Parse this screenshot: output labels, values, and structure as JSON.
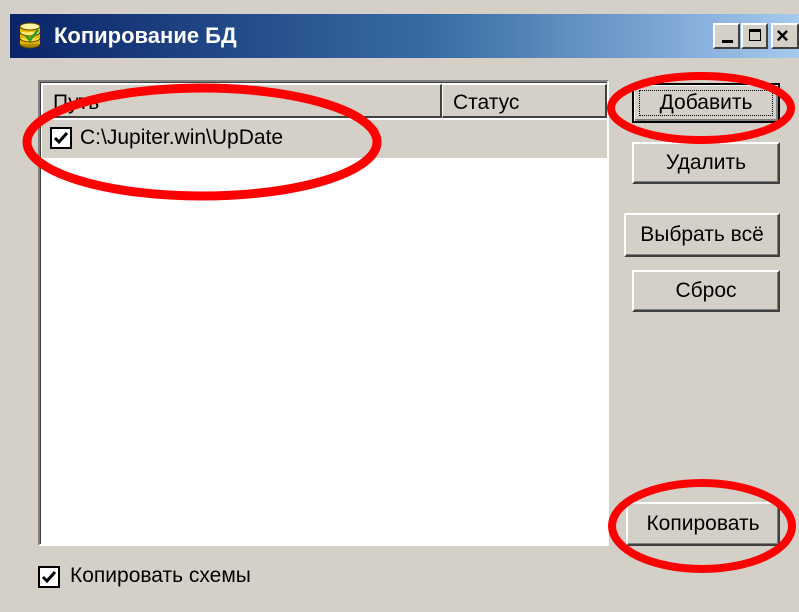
{
  "window": {
    "title": "Копирование БД",
    "icon": "database-icon",
    "controls": [
      "minimize-icon",
      "maximize-icon",
      "close-icon"
    ]
  },
  "list": {
    "columns": [
      "Путь",
      "Статус"
    ],
    "rows": [
      {
        "checked": true,
        "path": "C:\\Jupiter.win\\UpDate",
        "status": ""
      }
    ]
  },
  "buttons": {
    "add": "Добавить",
    "remove": "Удалить",
    "select_all": "Выбрать всё",
    "reset": "Сброс",
    "copy": "Копировать"
  },
  "options": {
    "copy_schemes": {
      "label": "Копировать схемы",
      "checked": true
    }
  },
  "annotations": {
    "highlight_color": "#ff0000"
  }
}
